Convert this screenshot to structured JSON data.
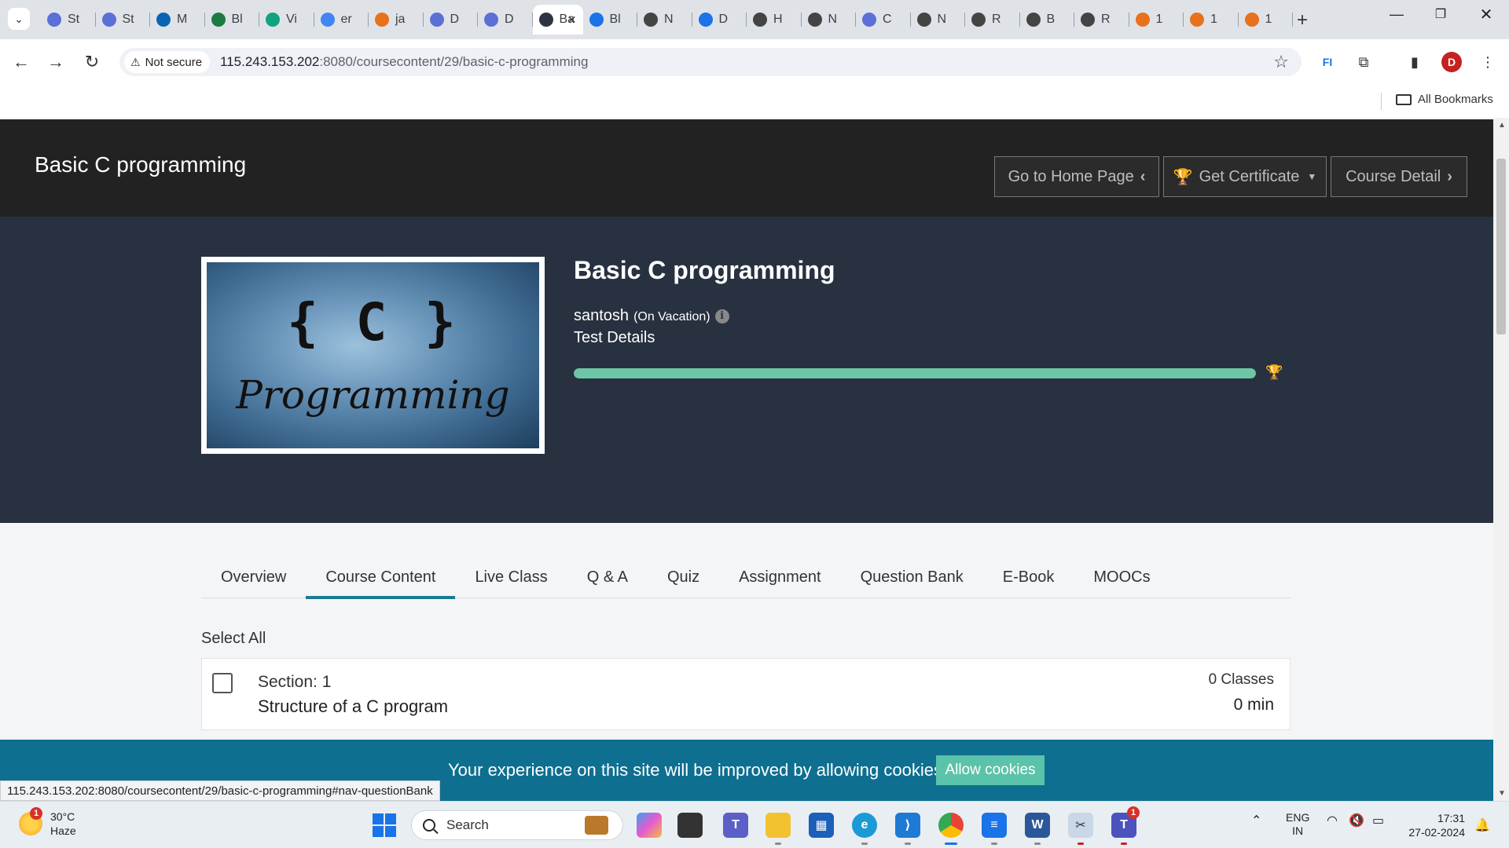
{
  "browser": {
    "tabs": [
      {
        "label": "St",
        "color": "#5b6fd6"
      },
      {
        "label": "St",
        "color": "#5b6fd6"
      },
      {
        "label": "M",
        "color": "#0a64b4"
      },
      {
        "label": "Bl",
        "color": "#1d7a43"
      },
      {
        "label": "Vi",
        "color": "#10a37f"
      },
      {
        "label": "er",
        "color": "#4285f4"
      },
      {
        "label": "ja",
        "color": "#e8711c"
      },
      {
        "label": "D",
        "color": "#5b6fd6"
      },
      {
        "label": "D",
        "color": "#5b6fd6"
      },
      {
        "label": "Ba",
        "color": "#2b3440",
        "active": true
      },
      {
        "label": "Bl",
        "color": "#1a73e8"
      },
      {
        "label": "N",
        "color": "#444"
      },
      {
        "label": "D",
        "color": "#1a73e8"
      },
      {
        "label": "H",
        "color": "#444"
      },
      {
        "label": "N",
        "color": "#444"
      },
      {
        "label": "C",
        "color": "#5b6fd6"
      },
      {
        "label": "N",
        "color": "#444"
      },
      {
        "label": "R",
        "color": "#444"
      },
      {
        "label": "B",
        "color": "#444"
      },
      {
        "label": "R",
        "color": "#444"
      },
      {
        "label": "1",
        "color": "#e8711c"
      },
      {
        "label": "1",
        "color": "#e8711c"
      },
      {
        "label": "1",
        "color": "#e8711c"
      }
    ],
    "security_label": "Not secure",
    "url_host": "115.243.153.202",
    "url_path": ":8080/coursecontent/29/basic-c-programming",
    "profile_initial": "D",
    "all_bookmarks": "All Bookmarks",
    "status_url": "115.243.153.202:8080/coursecontent/29/basic-c-programming#nav-questionBank"
  },
  "header": {
    "site_title": "Basic C programming",
    "home_btn": "Go to Home Page",
    "certificate_btn": "Get Certificate",
    "detail_btn": "Course Detail"
  },
  "course": {
    "thumb_code": "{ C }",
    "thumb_word": "Programming",
    "title": "Basic C programming",
    "instructor": "santosh",
    "instructor_status": "(On Vacation)",
    "test_details": "Test Details",
    "progress_percent": 100
  },
  "tabs": [
    {
      "label": "Overview",
      "active": false
    },
    {
      "label": "Course Content",
      "active": true
    },
    {
      "label": "Live Class",
      "active": false
    },
    {
      "label": "Q & A",
      "active": false
    },
    {
      "label": "Quiz",
      "active": false
    },
    {
      "label": "Assignment",
      "active": false
    },
    {
      "label": "Question Bank",
      "active": false
    },
    {
      "label": "E-Book",
      "active": false
    },
    {
      "label": "MOOCs",
      "active": false
    }
  ],
  "content": {
    "select_all": "Select All",
    "section_label": "Section: 1",
    "section_name": "Structure of a C program",
    "classes": "0 Classes",
    "duration": "0 min"
  },
  "cookie": {
    "text": "Your experience on this site will be improved by allowing cookies.",
    "button": "Allow cookies"
  },
  "taskbar": {
    "temperature": "30°C",
    "weather": "Haze",
    "weather_badge": "1",
    "search_placeholder": "Search",
    "language": "ENG",
    "region": "IN",
    "time": "17:31",
    "date": "27-02-2024",
    "teams_badge": "1"
  }
}
